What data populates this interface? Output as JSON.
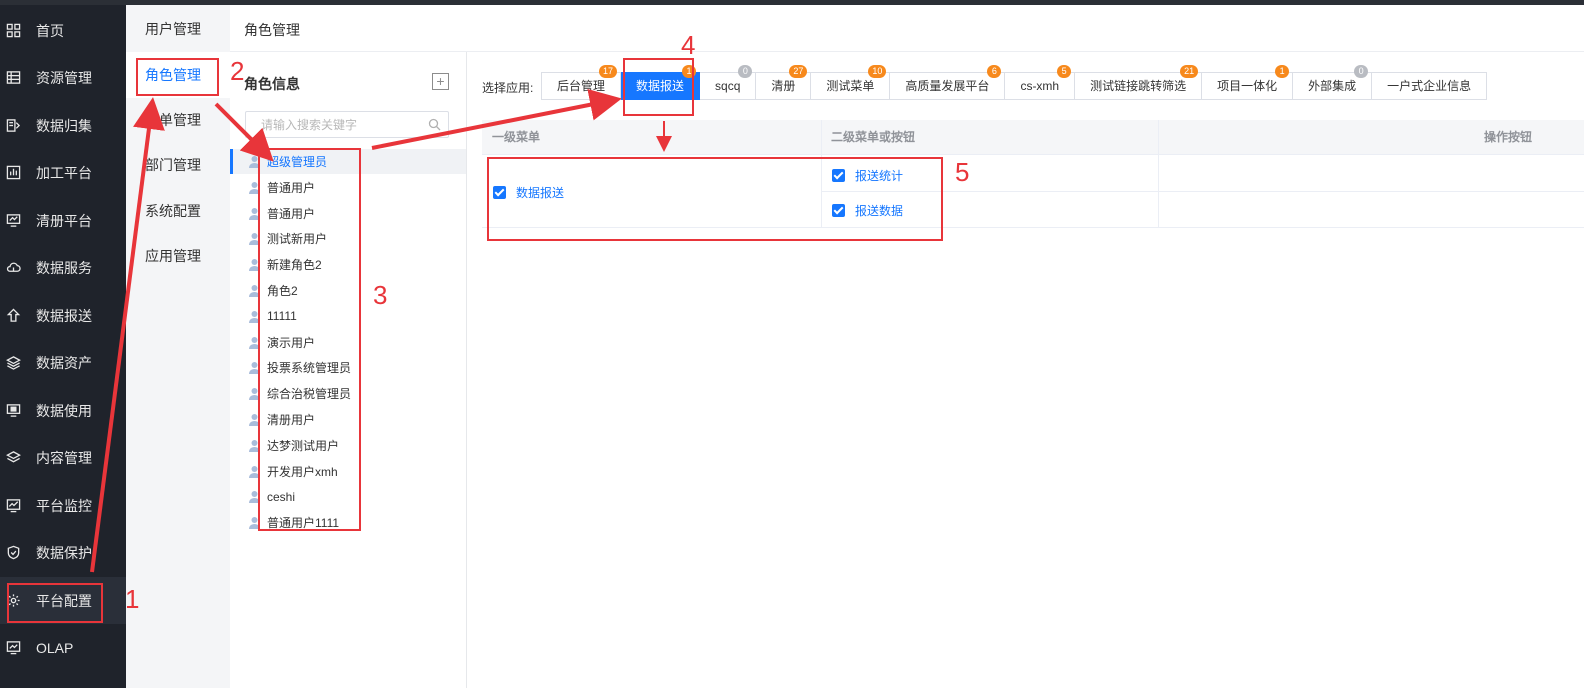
{
  "sidebar": {
    "items": [
      {
        "label": "首页",
        "icon": "grid-icon"
      },
      {
        "label": "资源管理",
        "icon": "table-icon"
      },
      {
        "label": "数据归集",
        "icon": "collect-icon"
      },
      {
        "label": "加工平台",
        "icon": "chart-bars-icon"
      },
      {
        "label": "清册平台",
        "icon": "monitor-icon"
      },
      {
        "label": "数据服务",
        "icon": "cloud-icon"
      },
      {
        "label": "数据报送",
        "icon": "upload-icon"
      },
      {
        "label": "数据资产",
        "icon": "layers-icon"
      },
      {
        "label": "数据使用",
        "icon": "screen-check-icon"
      },
      {
        "label": "内容管理",
        "icon": "stack-icon"
      },
      {
        "label": "平台监控",
        "icon": "monitor-chart-icon"
      },
      {
        "label": "数据保护",
        "icon": "shield-icon"
      },
      {
        "label": "平台配置",
        "icon": "gear-icon"
      },
      {
        "label": "OLAP",
        "icon": "olap-icon"
      }
    ],
    "active_index": 12
  },
  "subnav": {
    "items": [
      "用户管理",
      "角色管理",
      "菜单管理",
      "部门管理",
      "系统配置",
      "应用管理"
    ],
    "active_index": 1
  },
  "page": {
    "title": "角色管理"
  },
  "roles": {
    "title": "角色信息",
    "add_symbol": "+",
    "search_placeholder": "请输入搜索关键字",
    "items": [
      "超级管理员",
      "普通用户",
      "普通用户",
      "测试新用户",
      "新建角色2",
      "角色2",
      "11111",
      "演示用户",
      "投票系统管理员",
      "综合治税管理员",
      "清册用户",
      "达梦测试用户",
      "开发用户xmh",
      "ceshi",
      "普通用户1111"
    ],
    "active_index": 0
  },
  "apps": {
    "label": "选择应用:",
    "tabs": [
      {
        "label": "后台管理",
        "count": "17"
      },
      {
        "label": "数据报送",
        "count": "1"
      },
      {
        "label": "sqcq",
        "count": "0"
      },
      {
        "label": "清册",
        "count": "27"
      },
      {
        "label": "测试菜单",
        "count": "10"
      },
      {
        "label": "高质量发展平台",
        "count": "6"
      },
      {
        "label": "cs-xmh",
        "count": "5"
      },
      {
        "label": "测试链接跳转筛选",
        "count": "21"
      },
      {
        "label": "项目一体化",
        "count": "1"
      },
      {
        "label": "外部集成",
        "count": "0"
      },
      {
        "label": "一户式企业信息",
        "count": ""
      }
    ],
    "active_index": 1
  },
  "permissions": {
    "headers": [
      "一级菜单",
      "二级菜单或按钮",
      "操作按钮"
    ],
    "primary": "数据报送",
    "secondary": [
      "报送统计",
      "报送数据"
    ]
  },
  "annotations": [
    "1",
    "2",
    "3",
    "4",
    "5"
  ],
  "colors": {
    "accent": "#1677ff",
    "annotation": "#e8353a",
    "badge": "#f7891c",
    "sidebar_bg": "#1f232b"
  }
}
